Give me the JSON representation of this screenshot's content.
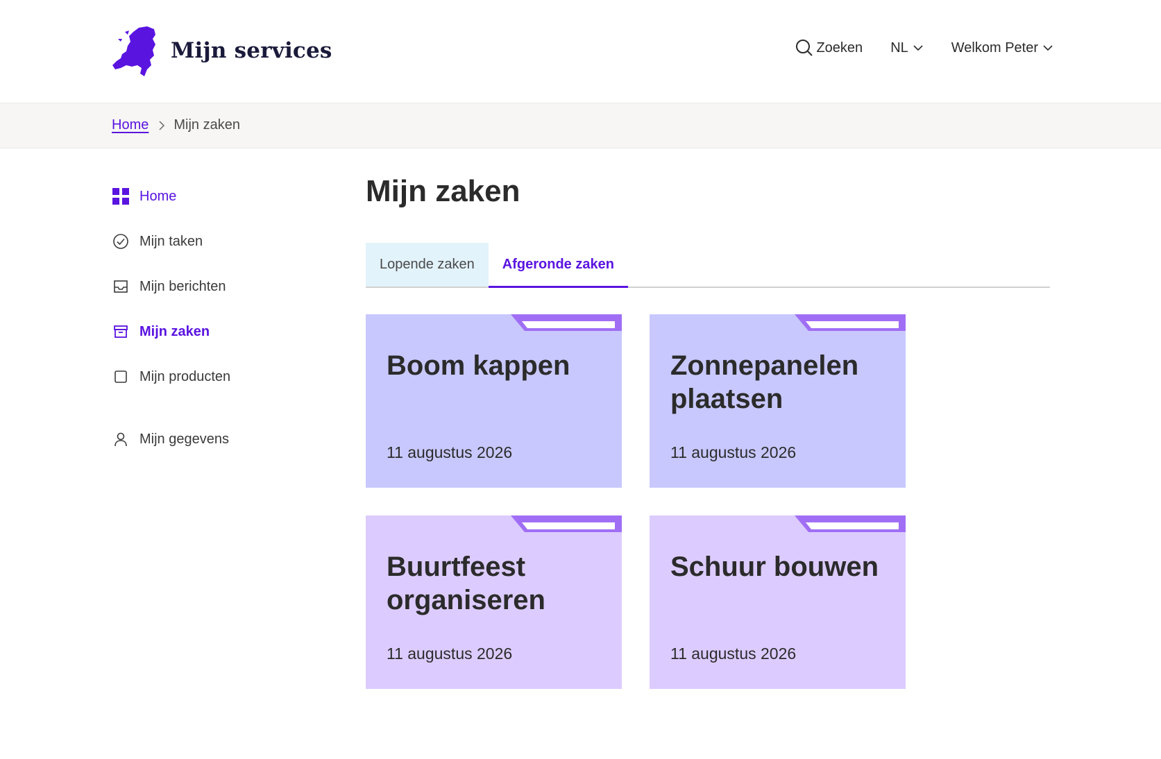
{
  "header": {
    "logo_text": "Mijn services",
    "search_label": "Zoeken",
    "language": "NL",
    "user_greeting": "Welkom Peter"
  },
  "breadcrumb": {
    "home": "Home",
    "current": "Mijn zaken"
  },
  "sidebar": {
    "items": [
      {
        "label": "Home",
        "icon": "grid-icon"
      },
      {
        "label": "Mijn taken",
        "icon": "check-circle-icon"
      },
      {
        "label": "Mijn berichten",
        "icon": "inbox-icon"
      },
      {
        "label": "Mijn zaken",
        "icon": "archive-icon"
      },
      {
        "label": "Mijn producten",
        "icon": "square-icon"
      },
      {
        "label": "Mijn gegevens",
        "icon": "user-icon"
      }
    ]
  },
  "main": {
    "title": "Mijn zaken",
    "tabs": [
      {
        "label": "Lopende zaken"
      },
      {
        "label": "Afgeronde zaken"
      }
    ],
    "cards": [
      {
        "title": "Boom kappen",
        "date": "11 augustus 2026"
      },
      {
        "title": "Zonnepanelen plaatsen",
        "date": "11 augustus 2026"
      },
      {
        "title": "Buurtfeest organiseren",
        "date": "11 augustus 2026"
      },
      {
        "title": "Schuur bouwen",
        "date": "11 augustus 2026"
      }
    ]
  },
  "colors": {
    "accent": "#5a14e0",
    "card_blue": "#c8c8ff",
    "card_lilac": "#dccbff",
    "card_tab": "#a06ef5",
    "tab_inactive_bg": "#e3f3fb",
    "breadcrumb_bg": "#f7f6f4"
  }
}
